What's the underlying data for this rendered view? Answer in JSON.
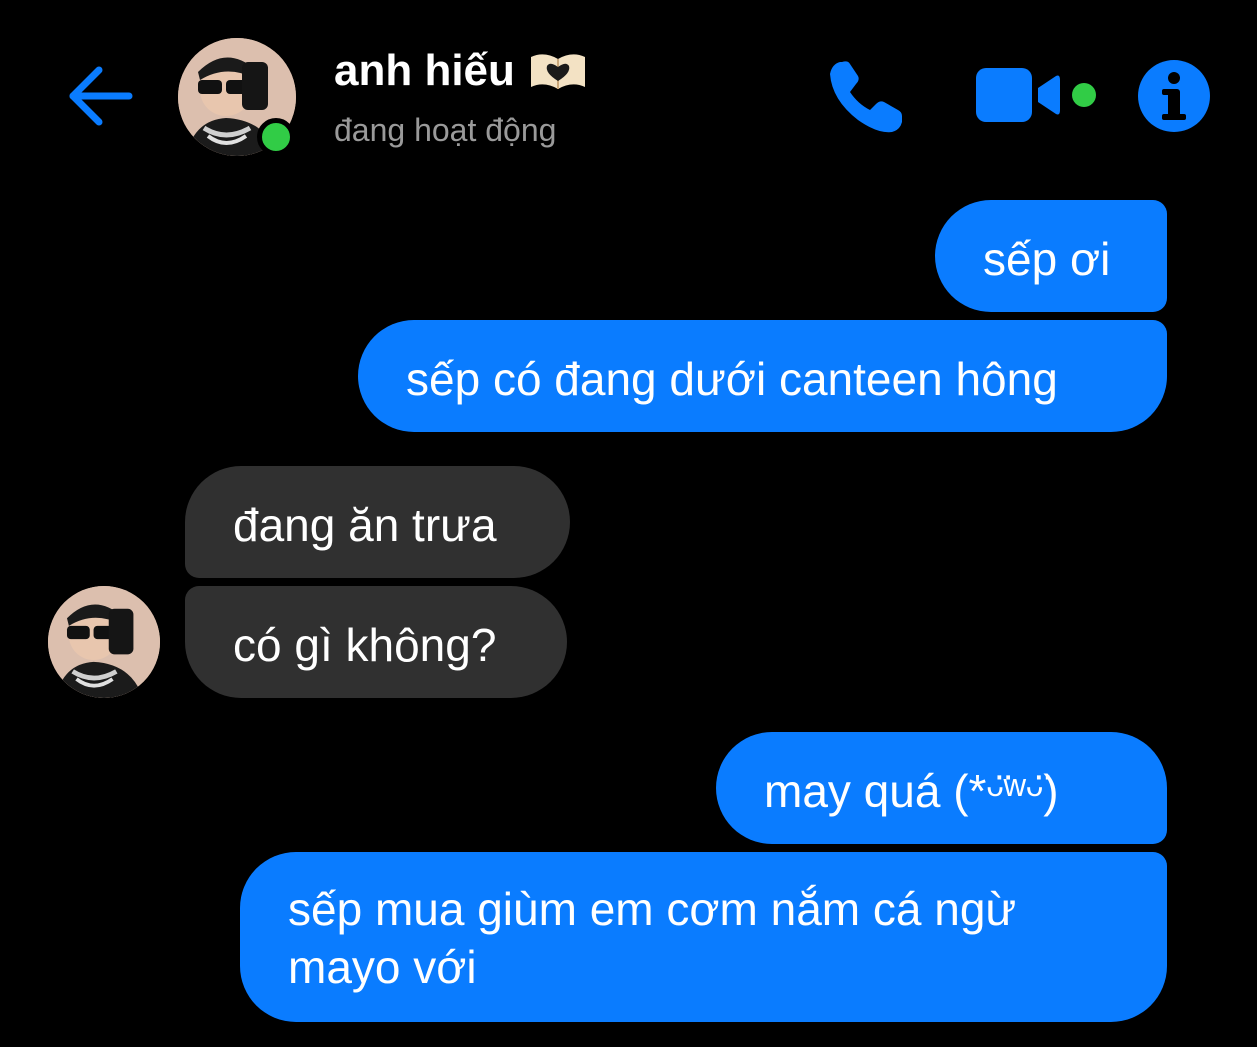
{
  "header": {
    "contact_name": "anh hiếu",
    "status": "đang hoạt động",
    "back_icon": "arrow-left-icon",
    "call_icon": "phone-icon",
    "video_icon": "video-camera-icon",
    "info_icon": "info-icon",
    "name_decoration_icon": "heart-book-icon"
  },
  "colors": {
    "accent": "#0a7cff",
    "incoming_bubble": "#303030",
    "online": "#31cc46",
    "background": "#000000",
    "status_text": "#9a9a9a"
  },
  "messages": [
    {
      "sender": "me",
      "text": "sếp ơi"
    },
    {
      "sender": "me",
      "text": "sếp có đang dưới canteen hông"
    },
    {
      "sender": "them",
      "text": "đang ăn trưa"
    },
    {
      "sender": "them",
      "text": "có gì không?"
    },
    {
      "sender": "me",
      "text": "may quá (*ᵕ̈ʷᵕ̈)"
    },
    {
      "sender": "me",
      "text": "sếp mua giùm em cơm nắm cá ngừ",
      "text2": "mayo với"
    }
  ]
}
